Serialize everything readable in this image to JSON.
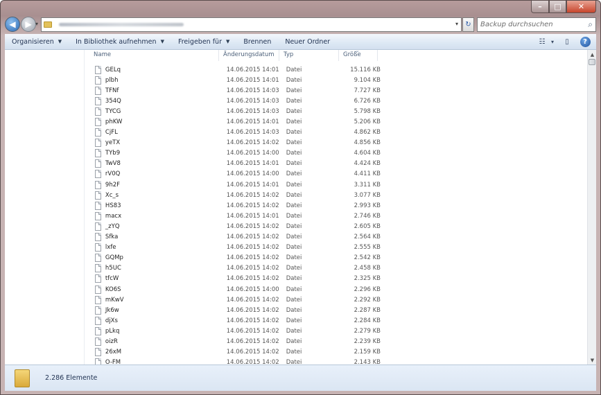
{
  "window": {
    "minimize": "–",
    "maximize": "□",
    "close": "✕"
  },
  "navigation": {
    "back": "◀",
    "forward": "▶",
    "recent": "▾",
    "address_dropdown": "▾",
    "refresh": "↻"
  },
  "search": {
    "placeholder": "Backup durchsuchen",
    "icon": "search-icon"
  },
  "toolbar": {
    "organize": "Organisieren",
    "library": "In Bibliothek aufnehmen",
    "share": "Freigeben für",
    "burn": "Brennen",
    "new_folder": "Neuer Ordner",
    "views": "☷",
    "views_caret": "▾",
    "preview": "▯",
    "help": "?"
  },
  "columns": {
    "name": "Name",
    "date": "Änderungsdatum",
    "type": "Typ",
    "size": "Größe"
  },
  "files": [
    {
      "name": "GELq",
      "date": "14.06.2015 14:01",
      "type": "Datei",
      "size": "15.116 KB"
    },
    {
      "name": "plbh",
      "date": "14.06.2015 14:01",
      "type": "Datei",
      "size": "9.104 KB"
    },
    {
      "name": "TFNf",
      "date": "14.06.2015 14:03",
      "type": "Datei",
      "size": "7.727 KB"
    },
    {
      "name": "354Q",
      "date": "14.06.2015 14:03",
      "type": "Datei",
      "size": "6.726 KB"
    },
    {
      "name": "TYCG",
      "date": "14.06.2015 14:03",
      "type": "Datei",
      "size": "5.798 KB"
    },
    {
      "name": "phKW",
      "date": "14.06.2015 14:01",
      "type": "Datei",
      "size": "5.206 KB"
    },
    {
      "name": "CjFL",
      "date": "14.06.2015 14:03",
      "type": "Datei",
      "size": "4.862 KB"
    },
    {
      "name": "yeTX",
      "date": "14.06.2015 14:02",
      "type": "Datei",
      "size": "4.856 KB"
    },
    {
      "name": "TYb9",
      "date": "14.06.2015 14:00",
      "type": "Datei",
      "size": "4.604 KB"
    },
    {
      "name": "TwV8",
      "date": "14.06.2015 14:01",
      "type": "Datei",
      "size": "4.424 KB"
    },
    {
      "name": "rV0Q",
      "date": "14.06.2015 14:00",
      "type": "Datei",
      "size": "4.411 KB"
    },
    {
      "name": "9h2F",
      "date": "14.06.2015 14:01",
      "type": "Datei",
      "size": "3.311 KB"
    },
    {
      "name": "Xc_s",
      "date": "14.06.2015 14:02",
      "type": "Datei",
      "size": "3.077 KB"
    },
    {
      "name": "HS83",
      "date": "14.06.2015 14:02",
      "type": "Datei",
      "size": "2.993 KB"
    },
    {
      "name": "macx",
      "date": "14.06.2015 14:01",
      "type": "Datei",
      "size": "2.746 KB"
    },
    {
      "name": "_zYQ",
      "date": "14.06.2015 14:02",
      "type": "Datei",
      "size": "2.605 KB"
    },
    {
      "name": "Sfka",
      "date": "14.06.2015 14:02",
      "type": "Datei",
      "size": "2.564 KB"
    },
    {
      "name": "lxfe",
      "date": "14.06.2015 14:02",
      "type": "Datei",
      "size": "2.555 KB"
    },
    {
      "name": "GQMp",
      "date": "14.06.2015 14:02",
      "type": "Datei",
      "size": "2.542 KB"
    },
    {
      "name": "h5UC",
      "date": "14.06.2015 14:02",
      "type": "Datei",
      "size": "2.458 KB"
    },
    {
      "name": "tfcW",
      "date": "14.06.2015 14:02",
      "type": "Datei",
      "size": "2.325 KB"
    },
    {
      "name": "KO6S",
      "date": "14.06.2015 14:00",
      "type": "Datei",
      "size": "2.296 KB"
    },
    {
      "name": "mKwV",
      "date": "14.06.2015 14:02",
      "type": "Datei",
      "size": "2.292 KB"
    },
    {
      "name": "Jk6w",
      "date": "14.06.2015 14:02",
      "type": "Datei",
      "size": "2.287 KB"
    },
    {
      "name": "djXs",
      "date": "14.06.2015 14:02",
      "type": "Datei",
      "size": "2.284 KB"
    },
    {
      "name": "pLkq",
      "date": "14.06.2015 14:02",
      "type": "Datei",
      "size": "2.279 KB"
    },
    {
      "name": "oizR",
      "date": "14.06.2015 14:02",
      "type": "Datei",
      "size": "2.239 KB"
    },
    {
      "name": "26xM",
      "date": "14.06.2015 14:02",
      "type": "Datei",
      "size": "2.159 KB"
    },
    {
      "name": "O-FM",
      "date": "14.06.2015 14:02",
      "type": "Datei",
      "size": "2.143 KB"
    }
  ],
  "status": {
    "count": "2.286 Elemente"
  },
  "scrollbar": {
    "up": "▲",
    "down": "▼"
  },
  "colors": {
    "toolbar_text": "#1e3050",
    "frame": "#b79c9c",
    "header_text": "#4c607a"
  }
}
